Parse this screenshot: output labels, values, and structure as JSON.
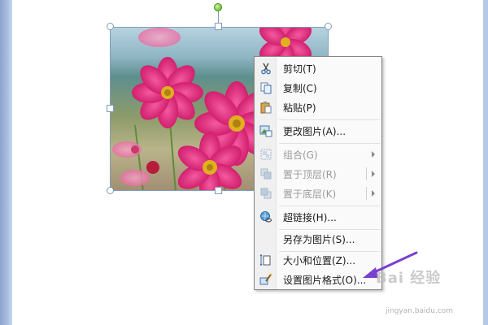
{
  "context_menu": {
    "items": [
      {
        "label": "剪切(T)",
        "icon": "scissors-icon",
        "disabled": false
      },
      {
        "label": "复制(C)",
        "icon": "copy-icon",
        "disabled": false
      },
      {
        "label": "粘贴(P)",
        "icon": "paste-icon",
        "disabled": false
      },
      {
        "label": "更改图片(A)...",
        "icon": "change-picture-icon",
        "disabled": false
      },
      {
        "label": "组合(G)",
        "icon": "group-icon",
        "disabled": true,
        "submenu": true
      },
      {
        "label": "置于顶层(R)",
        "icon": "bring-to-front-icon",
        "disabled": true,
        "submenu": true
      },
      {
        "label": "置于底层(K)",
        "icon": "send-to-back-icon",
        "disabled": true,
        "submenu": true
      },
      {
        "label": "超链接(H)...",
        "icon": "hyperlink-icon",
        "disabled": false
      },
      {
        "label": "另存为图片(S)...",
        "icon": "",
        "disabled": false
      },
      {
        "label": "大小和位置(Z)...",
        "icon": "size-position-icon",
        "disabled": false
      },
      {
        "label": "设置图片格式(O)...",
        "icon": "format-picture-icon",
        "disabled": false
      }
    ]
  },
  "watermark": {
    "text": "Bai 经验",
    "url": "jingyan.baidu.com"
  },
  "colors": {
    "accent_arrow": "#7a3fd0",
    "menu_border": "#868686",
    "selection_border": "#7f9db9"
  }
}
